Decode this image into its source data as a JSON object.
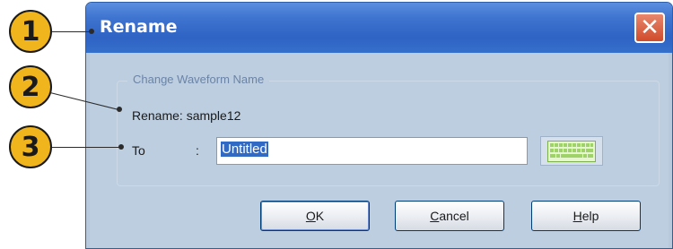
{
  "callouts": [
    "1",
    "2",
    "3"
  ],
  "dialog": {
    "title": "Rename",
    "close_glyph": "✕",
    "group_label": "Change Waveform Name",
    "rename_label": "Rename: sample12",
    "to_label": "To",
    "colon": ":",
    "to_value": "Untitled",
    "keyboard_icon": "keyboard-icon",
    "buttons": {
      "ok": {
        "first": "O",
        "rest": "K"
      },
      "cancel": {
        "first": "C",
        "rest": "ancel"
      },
      "help": {
        "first": "H",
        "rest": "elp"
      }
    }
  },
  "colors": {
    "callout": "#f0b41c",
    "titlebar": "#3f74d0",
    "client": "#bdcee1",
    "close": "#cf4b2b",
    "selection": "#316ac5"
  }
}
